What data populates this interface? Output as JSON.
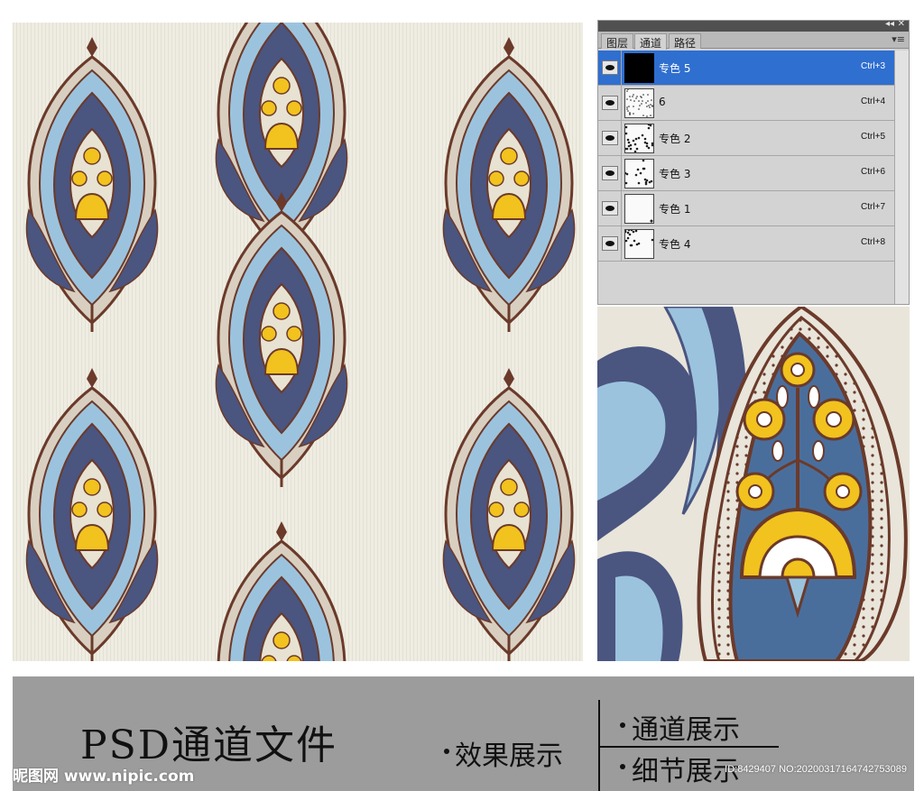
{
  "panel": {
    "tabs": [
      {
        "label": "图层"
      },
      {
        "label": "通道"
      },
      {
        "label": "路径"
      }
    ],
    "active_tab": "通道",
    "menu_icon": "panel-menu-icon",
    "collapse_glyph": "◂◂",
    "close_glyph": "✕",
    "menu_glyph": "▾≡",
    "channels": [
      {
        "name": "专色 5",
        "shortcut": "Ctrl+3",
        "selected": true,
        "thumb": "black"
      },
      {
        "name": "6",
        "shortcut": "Ctrl+4",
        "selected": false,
        "thumb": "texture"
      },
      {
        "name": "专色 2",
        "shortcut": "Ctrl+5",
        "selected": false,
        "thumb": "dense"
      },
      {
        "name": "专色 3",
        "shortcut": "Ctrl+6",
        "selected": false,
        "thumb": "medium"
      },
      {
        "name": "专色 1",
        "shortcut": "Ctrl+7",
        "selected": false,
        "thumb": "sparse"
      },
      {
        "name": "专色 4",
        "shortcut": "Ctrl+8",
        "selected": false,
        "thumb": "medium"
      }
    ]
  },
  "banner": {
    "title": "PSD通道文件",
    "item_effect": "效果展示",
    "item_channels": "通道展示",
    "item_detail": "细节展示"
  },
  "watermark": {
    "site": "昵图网 www.nipic.com",
    "id_text": "ID:8429407 NO:20200317164742753089"
  },
  "colors": {
    "background": "#efede2",
    "navy": "#4a5580",
    "light_blue": "#9cc3de",
    "yellow": "#f2c21e",
    "brown": "#6b3a2a",
    "selected": "#2f6fd0",
    "banner": "#9c9c9c"
  }
}
